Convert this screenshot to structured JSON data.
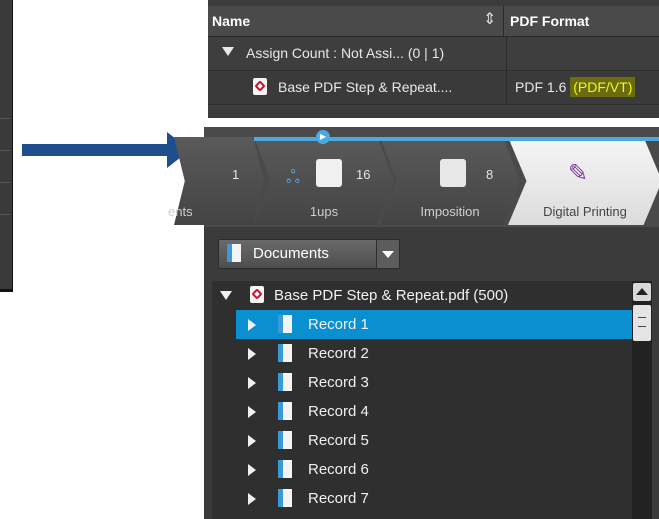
{
  "top_table": {
    "columns": {
      "name": "Name",
      "pdf_format": "PDF Format"
    },
    "group_row": {
      "label": "Assign Count : Not Assi...  (0 | 1)"
    },
    "file_row": {
      "name": "Base PDF Step & Repeat....",
      "format_version": "PDF 1.6",
      "format_highlight": "(PDF/VT)"
    }
  },
  "workflow_tabs": [
    {
      "title": "ents",
      "count": "1"
    },
    {
      "title": "1ups",
      "count": "16"
    },
    {
      "title": "Imposition",
      "count": "8"
    },
    {
      "title": "Digital Printing",
      "count": ""
    }
  ],
  "documents_dropdown": {
    "selected": "Documents"
  },
  "tree": {
    "root": {
      "label": "Base PDF Step & Repeat.pdf (500)"
    },
    "records": [
      "Record 1",
      "Record 2",
      "Record 3",
      "Record 4",
      "Record 5",
      "Record 6",
      "Record 7"
    ],
    "selected_index": 0
  },
  "colors": {
    "accent": "#0a8fd1",
    "arrow": "#1f4e8c",
    "highlight_text": "#f5f520"
  }
}
